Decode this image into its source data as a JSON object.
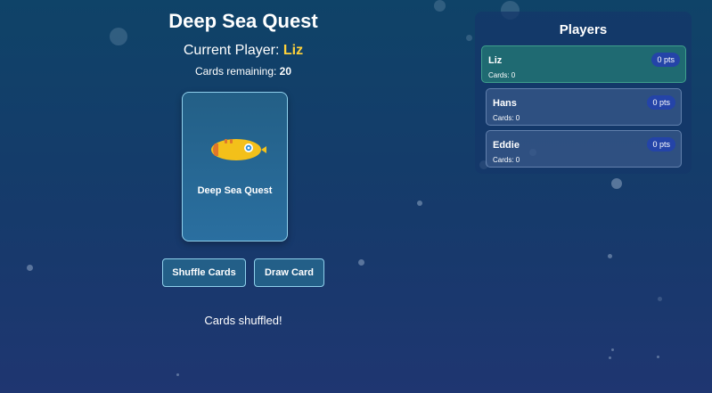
{
  "game": {
    "title": "Deep Sea Quest",
    "current_player_label": "Current Player: ",
    "current_player_name": "Liz",
    "cards_remaining_label": "Cards remaining: ",
    "cards_remaining_value": "20"
  },
  "card": {
    "icon": "submarine-icon",
    "label": "Deep Sea Quest"
  },
  "buttons": {
    "shuffle": "Shuffle Cards",
    "draw": "Draw Card"
  },
  "message": "Cards shuffled!",
  "players_panel": {
    "title": "Players",
    "players": [
      {
        "name": "Liz",
        "points": "0 pts",
        "cards": "Cards: 0",
        "active": true
      },
      {
        "name": "Hans",
        "points": "0 pts",
        "cards": "Cards: 0",
        "active": false
      },
      {
        "name": "Eddie",
        "points": "0 pts",
        "cards": "Cards: 0",
        "active": false
      }
    ]
  },
  "colors": {
    "accent_name": "#ffd23a",
    "active_player_bg": "#1f6a72",
    "points_badge": "#2444a8",
    "card_border": "#8fd0ec"
  }
}
